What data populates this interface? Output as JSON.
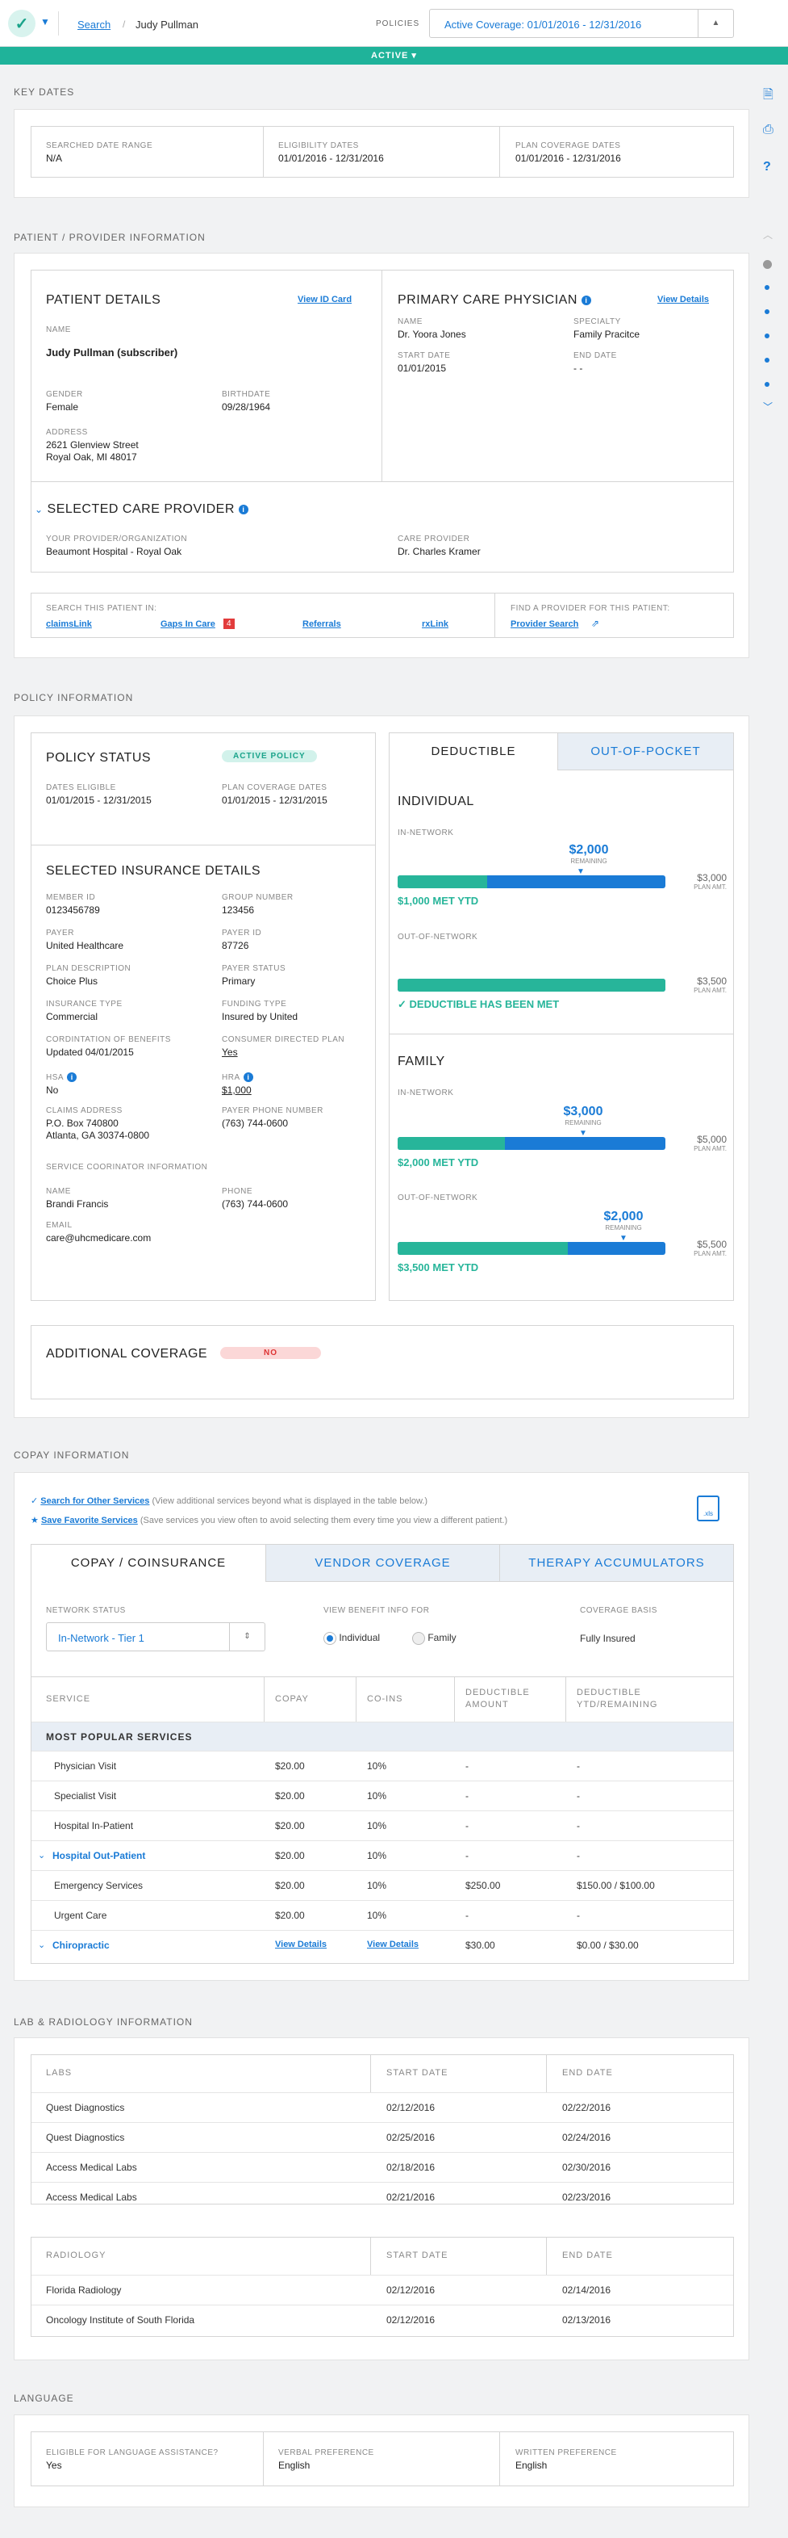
{
  "header": {
    "search": "Search",
    "separator": "/",
    "patient": "Judy Pullman",
    "policies_label": "POLICIES",
    "policy_value": "Active Coverage: 01/01/2016 - 12/31/2016",
    "status": "ACTIVE"
  },
  "key_dates": {
    "title": "KEY DATES",
    "items": [
      {
        "label": "SEARCHED DATE RANGE",
        "value": "N/A"
      },
      {
        "label": "ELIGIBILITY DATES",
        "value": "01/01/2016 - 12/31/2016"
      },
      {
        "label": "PLAN COVERAGE DATES",
        "value": "01/01/2016 - 12/31/2016"
      }
    ]
  },
  "patient_provider": {
    "title": "PATIENT / PROVIDER INFORMATION",
    "patient": {
      "heading": "PATIENT DETAILS",
      "link": "View ID Card",
      "name_label": "NAME",
      "name": "Judy Pullman (subscriber)",
      "gender_label": "GENDER",
      "gender": "Female",
      "birth_label": "BIRTHDATE",
      "birth": "09/28/1964",
      "address_label": "ADDRESS",
      "address1": "2621 Glenview Street",
      "address2": "Royal Oak, MI 48017"
    },
    "pcp": {
      "heading": "PRIMARY CARE PHYSICIAN",
      "link": "View Details",
      "name_label": "NAME",
      "name": "Dr. Yoora Jones",
      "specialty_label": "SPECIALTY",
      "specialty": "Family Pracitce",
      "start_label": "START DATE",
      "start": "01/01/2015",
      "end_label": "END DATE",
      "end": "- -"
    },
    "scp": {
      "heading": "SELECTED CARE PROVIDER",
      "org_label": "YOUR PROVIDER/ORGANIZATION",
      "org": "Beaumont Hospital - Royal Oak",
      "cp_label": "CARE PROVIDER",
      "cp": "Dr. Charles Kramer"
    },
    "search_in": {
      "label": "SEARCH THIS PATIENT IN:",
      "links": [
        "claimsLink",
        "Gaps In Care",
        "Referrals",
        "rxLink"
      ],
      "gaps_badge": "4",
      "find_label": "FIND A PROVIDER FOR THIS PATIENT:",
      "find_link": "Provider Search"
    }
  },
  "policy": {
    "title": "POLICY INFORMATION",
    "status": {
      "heading": "POLICY STATUS",
      "pill": "ACTIVE POLICY",
      "de_label": "DATES ELIGIBLE",
      "de": "01/01/2015 - 12/31/2015",
      "pc_label": "PLAN COVERAGE DATES",
      "pc": "01/01/2015 - 12/31/2015"
    },
    "insurance": {
      "heading": "SELECTED INSURANCE DETAILS",
      "fields": [
        {
          "label": "MEMBER ID",
          "value": "0123456789"
        },
        {
          "label": "GROUP NUMBER",
          "value": "123456"
        },
        {
          "label": "PAYER",
          "value": "United Healthcare"
        },
        {
          "label": "PAYER ID",
          "value": "87726"
        },
        {
          "label": "PLAN DESCRIPTION",
          "value": "Choice Plus"
        },
        {
          "label": "PAYER STATUS",
          "value": "Primary"
        },
        {
          "label": "INSURANCE TYPE",
          "value": "Commercial"
        },
        {
          "label": "FUNDING TYPE",
          "value": "Insured by United"
        },
        {
          "label": "CORDINTATION OF BENEFITS",
          "value": "Updated 04/01/2015"
        },
        {
          "label": "CONSUMER DIRECTED PLAN",
          "value": "Yes"
        },
        {
          "label": "HSA",
          "value": "No"
        },
        {
          "label": "HRA",
          "value": "$1,000"
        },
        {
          "label": "CLAIMS ADDRESS",
          "value": "P.O. Box 740800",
          "value2": "Atlanta, GA 30374-0800"
        },
        {
          "label": "PAYER PHONE NUMBER",
          "value": "(763) 744-0600"
        }
      ],
      "coord_heading": "SERVICE COORINATOR INFORMATION",
      "coord_name_label": "NAME",
      "coord_name": "Brandi Francis",
      "coord_phone_label": "PHONE",
      "coord_phone": "(763) 744-0600",
      "email_label": "EMAIL",
      "email": "care@uhcmedicare.com"
    },
    "tabs": [
      "DEDUCTIBLE",
      "OUT-OF-POCKET"
    ],
    "individual": {
      "heading": "INDIVIDUAL",
      "in_label": "IN-NETWORK",
      "in_remaining": "$2,000",
      "remaining_label": "REMAINING",
      "in_total": "$3,000",
      "plan_amt": "PLAN AMT.",
      "in_met": "$1,000 MET YTD",
      "in_met_fraction": 0.3333,
      "out_label": "OUT-OF-NETWORK",
      "out_total": "$3,500",
      "out_met": "DEDUCTIBLE HAS BEEN MET",
      "out_met_fraction": 1
    },
    "family": {
      "heading": "FAMILY",
      "in_label": "IN-NETWORK",
      "in_remaining": "$3,000",
      "in_total": "$5,000",
      "in_met": "$2,000 MET YTD",
      "in_met_fraction": 0.4,
      "out_label": "OUT-OF-NETWORK",
      "out_remaining": "$2,000",
      "out_total": "$5,500",
      "out_met": "$3,500 MET YTD",
      "out_met_fraction": 0.6364
    },
    "additional": {
      "heading": "ADDITIONAL COVERAGE",
      "pill": "NO"
    }
  },
  "copay": {
    "title": "COPAY INFORMATION",
    "link1": "Search for Other Services",
    "desc1": "(View additional services beyond what is displayed in the table below.)",
    "link2": "Save Favorite Services",
    "desc2": "(Save services you view often to avoid selecting them every time you view a different patient.)",
    "xls": ".xls",
    "tabs": [
      "COPAY / COINSURANCE",
      "VENDOR COVERAGE",
      "THERAPY ACCUMULATORS"
    ],
    "network_label": "NETWORK STATUS",
    "network_value": "In-Network - Tier 1",
    "view_label": "VIEW BENEFIT INFO FOR",
    "radio1": "Individual",
    "radio2": "Family",
    "basis_label": "COVERAGE BASIS",
    "basis_value": "Fully Insured",
    "columns": [
      "SERVICE",
      "COPAY",
      "CO-INS",
      "DEDUCTIBLE AMOUNT",
      "DEDUCTIBLE YTD/REMAINING"
    ],
    "group": "MOST POPULAR SERVICES",
    "rows": [
      {
        "service": "Physician Visit",
        "copay": "$20.00",
        "coins": "10%",
        "ded": "-",
        "ytd": "-"
      },
      {
        "service": "Specialist Visit",
        "copay": "$20.00",
        "coins": "10%",
        "ded": "-",
        "ytd": "-"
      },
      {
        "service": "Hospital In-Patient",
        "copay": "$20.00",
        "coins": "10%",
        "ded": "-",
        "ytd": "-"
      },
      {
        "service": "Hospital Out-Patient",
        "copay": "$20.00",
        "coins": "10%",
        "ded": "-",
        "ytd": "-"
      },
      {
        "service": "Emergency Services",
        "copay": "$20.00",
        "coins": "10%",
        "ded": "$250.00",
        "ytd": "$150.00 / $100.00"
      },
      {
        "service": "Urgent Care",
        "copay": "$20.00",
        "coins": "10%",
        "ded": "-",
        "ytd": "-"
      },
      {
        "service": "Chiropractic",
        "copay": "View Details",
        "coins": "View Details",
        "ded": "$30.00",
        "ytd": "$0.00 / $30.00"
      }
    ]
  },
  "lab": {
    "title": "LAB & RADIOLOGY INFORMATION",
    "labs_cols": [
      "LABS",
      "START DATE",
      "END DATE"
    ],
    "labs": [
      {
        "name": "Quest Diagnostics",
        "start": "02/12/2016",
        "end": "02/22/2016"
      },
      {
        "name": "Quest Diagnostics",
        "start": "02/25/2016",
        "end": "02/24/2016"
      },
      {
        "name": "Access Medical Labs",
        "start": "02/18/2016",
        "end": "02/30/2016"
      },
      {
        "name": "Access Medical Labs",
        "start": "02/21/2016",
        "end": "02/23/2016"
      }
    ],
    "rad_cols": [
      "RADIOLOGY",
      "START DATE",
      "END DATE"
    ],
    "rad": [
      {
        "name": "Florida Radiology",
        "start": "02/12/2016",
        "end": "02/14/2016"
      },
      {
        "name": "Oncology Institute of South Florida",
        "start": "02/12/2016",
        "end": "02/13/2016"
      }
    ]
  },
  "language": {
    "title": "LANGUAGE",
    "items": [
      {
        "label": "ELIGIBLE FOR LANGUAGE ASSISTANCE?",
        "value": "Yes"
      },
      {
        "label": "VERBAL PREFERENCE",
        "value": "English"
      },
      {
        "label": "WRITTEN PREFERENCE",
        "value": "English"
      }
    ]
  },
  "colors": {
    "accent": "#1a7bd6",
    "green": "#27b59a",
    "active": "#1fb39a"
  }
}
